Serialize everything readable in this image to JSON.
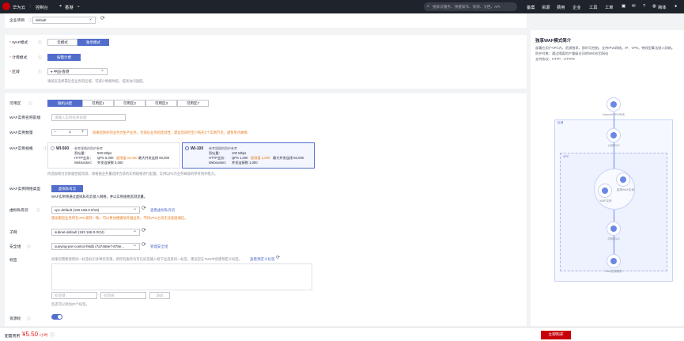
{
  "topbar": {
    "brand": "华为云",
    "console": "控制台",
    "region": "香港",
    "search_placeholder": "搜索云服务、快捷操作、资源、文档、API",
    "nav": [
      "备案",
      "资源",
      "费用",
      "企业",
      "工具",
      "工单"
    ],
    "user": "简体"
  },
  "enterprise_project": {
    "label": "企业项目",
    "value": "default"
  },
  "waf_mode": {
    "label": "WAF模式",
    "options": [
      "云模式",
      "独享模式"
    ],
    "selected": "独享模式"
  },
  "billing": {
    "label": "计费模式",
    "value": "按需计费"
  },
  "region": {
    "label": "区域",
    "value": "中国-香港",
    "hint": "请就近选择靠近您业务的区域，可减少网络时延、提高访问速度。"
  },
  "az": {
    "label": "可用区",
    "options": [
      "随机分配",
      "可用区1",
      "可用区2",
      "可用区3",
      "可用区7"
    ],
    "selected": "随机分配"
  },
  "instance_name": {
    "label": "WAF实例名称前缀",
    "placeholder": "请输入实例名称前缀"
  },
  "instance_count": {
    "label": "WAF实例数量",
    "value": "1",
    "warn": "如果您防护的业务为生产业务，为保证业务的连续性，建议您同时至少购买2个实例节点，避免单点故障"
  },
  "spec": {
    "label": "WAF实例规格",
    "options": [
      {
        "name": "WI-500",
        "desc": "参考规格的防护参考",
        "bandwidth_label": "吞吐量：",
        "bandwidth": "500 Mbps",
        "http_label": "HTTP业务：",
        "qps": "QPS 5,000",
        "peak": "超限值 10,000",
        "conn": "最大并发连接 60,000",
        "ws_label": "Websocket：",
        "ws": "并发连接数 5,000"
      },
      {
        "name": "WI-100",
        "desc": "参考规格的防护参考",
        "bandwidth_label": "吞吐量：",
        "bandwidth": "100 Mbps",
        "http_label": "HTTP业务：",
        "qps": "QPS 1,000",
        "peak": "超限值 2,000",
        "conn": "最大并发连接 60,000",
        "ws_label": "Websocket：",
        "ws": "并发连接数 1,000"
      }
    ],
    "selected": "WI-100",
    "hint": "所选规格为您依据性能资源，请根据业务量选择合适的实例规格进行配置。实例QPS为业务峰值的参考防护能力。"
  },
  "network_type": {
    "label": "WAF实例网络类型",
    "value": "虚拟私有云",
    "hint": "WAF实例将通过虚拟私有云接入网络，并以实例规格监测流量。"
  },
  "vpc": {
    "label": "虚拟私有云",
    "value": "vpc-default (192.168.0.0/16)",
    "link": "查看虚拟私有云",
    "warn": "建议跟您业务所在VPC保持一致，可以更加便捷地开展业务，不同VPC之间无法直接通信。"
  },
  "subnet": {
    "label": "子网",
    "value": "subnet-default (192.168.0.0/24)"
  },
  "security_group": {
    "label": "安全组",
    "value": "xueying-pre-control-h9db (7a7466e7-878e...",
    "link": "管理安全组"
  },
  "tags": {
    "label": "标签",
    "hint": "如果您需要使用同一标签标识多种云资源，即所有服务均可在标签输入框下拉选择同一标签，建议您在TMS中创建预定义标签。",
    "link": "查看预定义标签",
    "key_placeholder": "标签键",
    "value_placeholder": "标签值",
    "add": "添加",
    "count_hint": "您还可以添加20个标签。"
  },
  "auto_renew": {
    "label": "资源标",
    "on": true
  },
  "footer": {
    "fee_label": "配置费用",
    "price": "¥5.50",
    "unit": "/小时",
    "buy": "立即购买"
  },
  "diagram": {
    "title": "独享WAF模式简介",
    "desc1": "部署在用户VPC内，资源独享，即时可控制，支持IPv6网络，IP、VPN，带线型算法接入网络。",
    "desc2": "防护对象：通过隔离的产量级访问的Web应用网站",
    "desc3": "支持协议：HTTP、HTTPS",
    "nodes": [
      "Internet/VPN专线",
      "公网 ELB",
      "VPC",
      "独享WAF实例",
      "WAF实例",
      "内网 ELB",
      "Web应用服务"
    ],
    "zone_label": "区域"
  },
  "colors": {
    "accent": "#526ecc",
    "warn": "#e77a1c",
    "buy": "#c7000b"
  }
}
